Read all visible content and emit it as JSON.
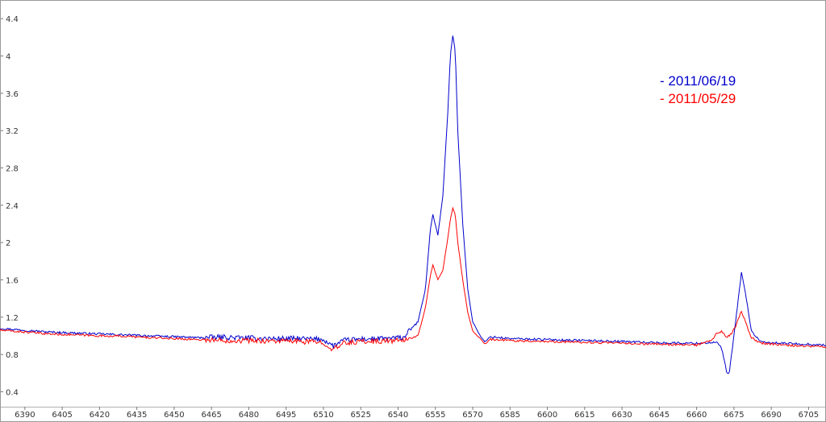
{
  "chart_data": {
    "type": "line",
    "title": "",
    "xlabel": "",
    "ylabel": "",
    "xlim": [
      6380,
      6712
    ],
    "ylim": [
      0.24,
      4.6
    ],
    "x_ticks": [
      6390,
      6405,
      6420,
      6435,
      6450,
      6465,
      6480,
      6495,
      6510,
      6525,
      6540,
      6555,
      6570,
      6585,
      6600,
      6615,
      6630,
      6645,
      6660,
      6675,
      6690,
      6705
    ],
    "y_ticks": [
      0.4,
      0.8,
      1.2,
      1.6,
      2,
      2.4,
      2.8,
      3.2,
      3.6,
      4,
      4.4
    ],
    "grid": false,
    "legend_position": "top-right",
    "series": [
      {
        "name": "- 2011/06/19",
        "color": "#0000cc",
        "points": [
          [
            6380,
            1.08
          ],
          [
            6390,
            1.06
          ],
          [
            6400,
            1.04
          ],
          [
            6410,
            1.03
          ],
          [
            6420,
            1.02
          ],
          [
            6430,
            1.01
          ],
          [
            6440,
            1.0
          ],
          [
            6450,
            0.99
          ],
          [
            6460,
            0.98
          ],
          [
            6470,
            0.985
          ],
          [
            6480,
            0.975
          ],
          [
            6490,
            0.97
          ],
          [
            6500,
            0.97
          ],
          [
            6510,
            0.96
          ],
          [
            6514,
            0.89
          ],
          [
            6518,
            0.95
          ],
          [
            6525,
            0.965
          ],
          [
            6535,
            0.97
          ],
          [
            6542,
            0.98
          ],
          [
            6548,
            1.15
          ],
          [
            6551,
            1.5
          ],
          [
            6553,
            2.15
          ],
          [
            6554,
            2.3
          ],
          [
            6556,
            2.08
          ],
          [
            6558,
            2.5
          ],
          [
            6560,
            3.4
          ],
          [
            6561,
            4.0
          ],
          [
            6562,
            4.22
          ],
          [
            6563,
            4.05
          ],
          [
            6564,
            3.2
          ],
          [
            6566,
            2.2
          ],
          [
            6568,
            1.5
          ],
          [
            6570,
            1.15
          ],
          [
            6573,
            1.0
          ],
          [
            6575,
            0.93
          ],
          [
            6577,
            0.99
          ],
          [
            6585,
            0.97
          ],
          [
            6600,
            0.96
          ],
          [
            6615,
            0.95
          ],
          [
            6630,
            0.94
          ],
          [
            6645,
            0.925
          ],
          [
            6660,
            0.92
          ],
          [
            6668,
            0.93
          ],
          [
            6670,
            0.87
          ],
          [
            6672,
            0.62
          ],
          [
            6673,
            0.58
          ],
          [
            6675,
            1.0
          ],
          [
            6677,
            1.45
          ],
          [
            6678,
            1.68
          ],
          [
            6680,
            1.4
          ],
          [
            6682,
            1.05
          ],
          [
            6686,
            0.93
          ],
          [
            6695,
            0.92
          ],
          [
            6705,
            0.91
          ],
          [
            6712,
            0.9
          ]
        ]
      },
      {
        "name": "- 2011/05/29",
        "color": "#ff0000",
        "points": [
          [
            6380,
            1.06
          ],
          [
            6390,
            1.04
          ],
          [
            6400,
            1.02
          ],
          [
            6410,
            1.01
          ],
          [
            6420,
            1.0
          ],
          [
            6430,
            0.995
          ],
          [
            6440,
            0.98
          ],
          [
            6450,
            0.97
          ],
          [
            6460,
            0.96
          ],
          [
            6470,
            0.95
          ],
          [
            6480,
            0.95
          ],
          [
            6490,
            0.945
          ],
          [
            6500,
            0.94
          ],
          [
            6510,
            0.93
          ],
          [
            6514,
            0.85
          ],
          [
            6518,
            0.92
          ],
          [
            6525,
            0.94
          ],
          [
            6535,
            0.945
          ],
          [
            6542,
            0.95
          ],
          [
            6548,
            1.0
          ],
          [
            6551,
            1.3
          ],
          [
            6553,
            1.65
          ],
          [
            6554,
            1.76
          ],
          [
            6556,
            1.6
          ],
          [
            6558,
            1.7
          ],
          [
            6560,
            2.05
          ],
          [
            6561,
            2.25
          ],
          [
            6562,
            2.37
          ],
          [
            6563,
            2.3
          ],
          [
            6564,
            2.0
          ],
          [
            6566,
            1.6
          ],
          [
            6568,
            1.25
          ],
          [
            6570,
            1.05
          ],
          [
            6573,
            0.97
          ],
          [
            6575,
            0.91
          ],
          [
            6577,
            0.96
          ],
          [
            6585,
            0.95
          ],
          [
            6600,
            0.94
          ],
          [
            6615,
            0.93
          ],
          [
            6630,
            0.92
          ],
          [
            6645,
            0.91
          ],
          [
            6660,
            0.9
          ],
          [
            6666,
            0.95
          ],
          [
            6668,
            1.02
          ],
          [
            6670,
            1.05
          ],
          [
            6672,
            0.98
          ],
          [
            6674,
            1.02
          ],
          [
            6676,
            1.12
          ],
          [
            6677,
            1.2
          ],
          [
            6678,
            1.26
          ],
          [
            6680,
            1.12
          ],
          [
            6682,
            0.98
          ],
          [
            6686,
            0.92
          ],
          [
            6695,
            0.9
          ],
          [
            6705,
            0.89
          ],
          [
            6712,
            0.88
          ]
        ]
      }
    ]
  }
}
